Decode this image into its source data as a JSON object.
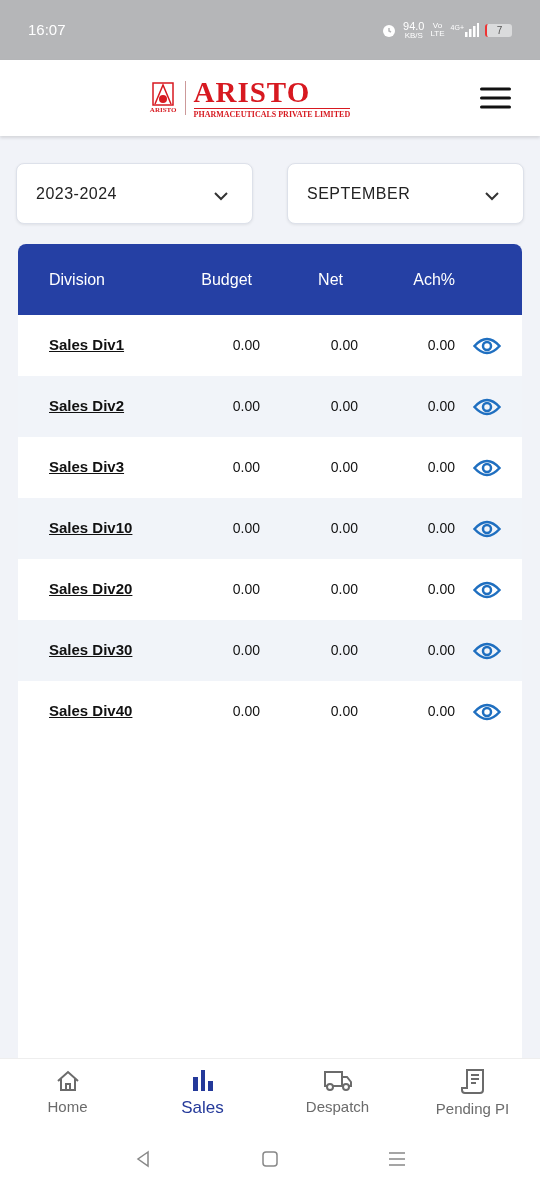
{
  "status_bar": {
    "time": "16:07",
    "speed": "94.0",
    "speed_unit": "KB/S",
    "volte": "Vo",
    "volte_sub": "LTE",
    "network": "4G+",
    "battery": "7"
  },
  "header": {
    "logo_mark_text": "ARISTO",
    "logo_title": "ARISTO",
    "logo_subtitle": "PHARMACEUTICALS PRIVATE LIMITED"
  },
  "filters": [
    {
      "value": "2023-2024"
    },
    {
      "value": "SEPTEMBER"
    }
  ],
  "table": {
    "columns": [
      "Division",
      "Budget",
      "Net",
      "Ach%"
    ],
    "rows": [
      {
        "division": "Sales Div1",
        "budget": "0.00",
        "net": "0.00",
        "ach": "0.00"
      },
      {
        "division": "Sales Div2",
        "budget": "0.00",
        "net": "0.00",
        "ach": "0.00"
      },
      {
        "division": "Sales Div3",
        "budget": "0.00",
        "net": "0.00",
        "ach": "0.00"
      },
      {
        "division": "Sales Div10",
        "budget": "0.00",
        "net": "0.00",
        "ach": "0.00"
      },
      {
        "division": "Sales Div20",
        "budget": "0.00",
        "net": "0.00",
        "ach": "0.00"
      },
      {
        "division": "Sales Div30",
        "budget": "0.00",
        "net": "0.00",
        "ach": "0.00"
      },
      {
        "division": "Sales Div40",
        "budget": "0.00",
        "net": "0.00",
        "ach": "0.00"
      }
    ]
  },
  "bottom_nav": [
    {
      "label": "Home",
      "kind": "home",
      "selected": false
    },
    {
      "label": "Sales",
      "kind": "sales",
      "selected": true
    },
    {
      "label": "Despatch",
      "kind": "truck",
      "selected": false
    },
    {
      "label": "Pending PI",
      "kind": "receipt",
      "selected": false
    }
  ]
}
